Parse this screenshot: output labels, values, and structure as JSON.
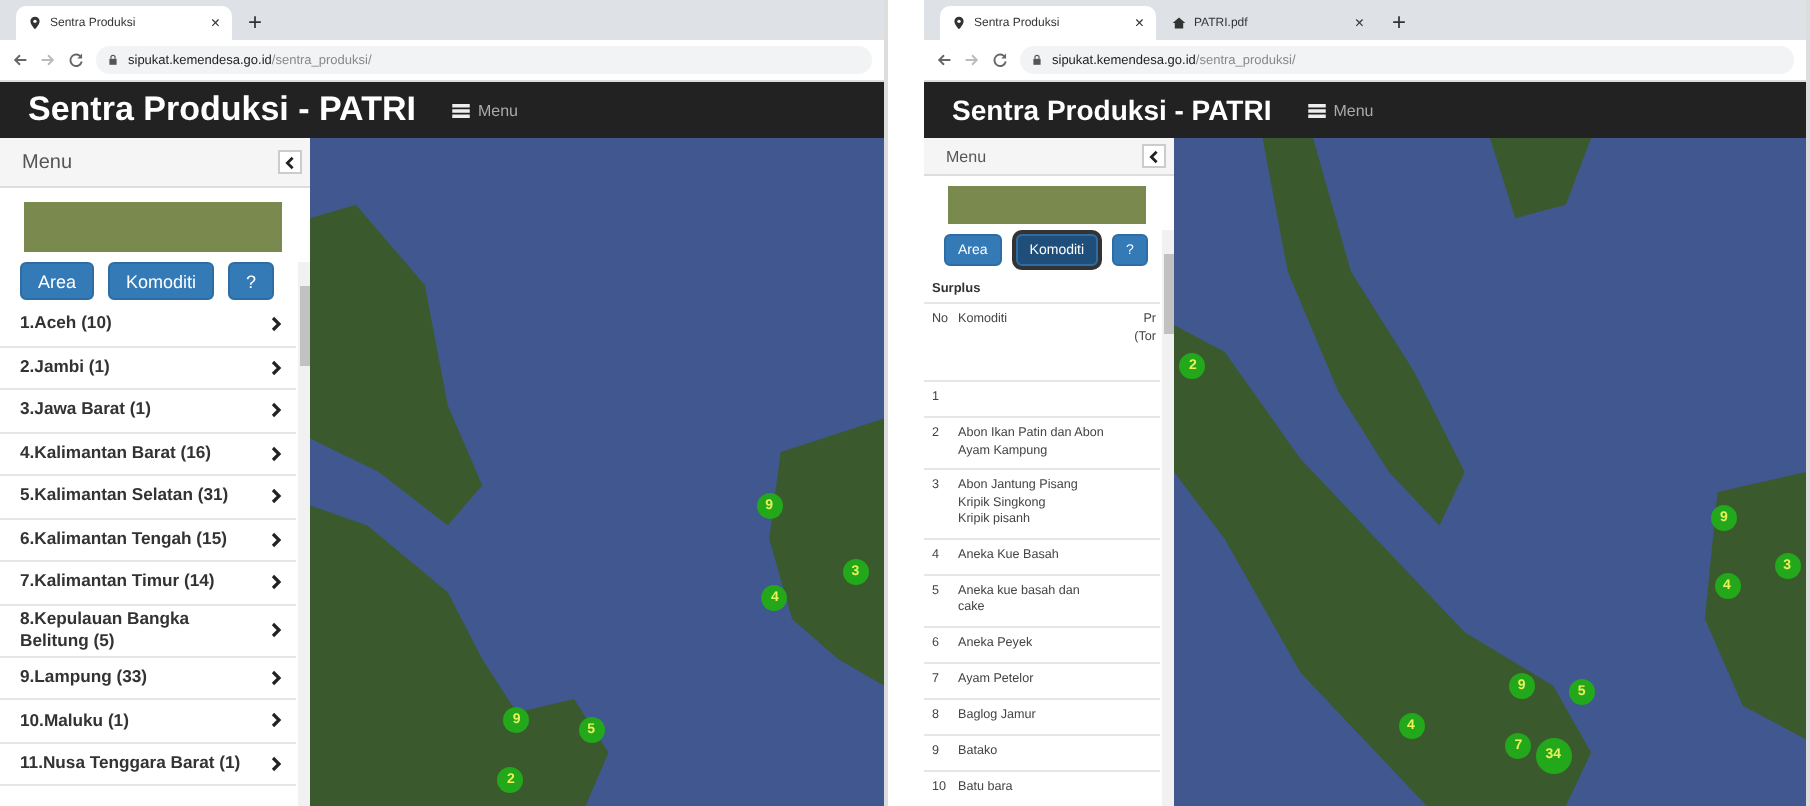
{
  "panels": [
    {
      "browser": {
        "tabs": [
          {
            "title": "Sentra Produksi",
            "close": "×",
            "selected": true
          }
        ],
        "new_tab": "+",
        "url_host": "sipukat.kemendesa.go.id",
        "url_path": "/sentra_produksi/"
      },
      "app": {
        "title": "Sentra Produksi - PATRI",
        "menu_label": "Menu"
      },
      "sidebar": {
        "kind": "list",
        "title": "Menu",
        "buttons": [
          {
            "label": "Area",
            "selected": false
          },
          {
            "label": "Komoditi",
            "selected": false
          },
          {
            "label": "?",
            "selected": false
          }
        ],
        "items": [
          {
            "label": "1.Aceh (10)"
          },
          {
            "label": "2.Jambi (1)"
          },
          {
            "label": "3.Jawa Barat (1)"
          },
          {
            "label": "4.Kalimantan Barat (16)"
          },
          {
            "label": "5.Kalimantan Selatan (31)"
          },
          {
            "label": "6.Kalimantan Tengah (15)"
          },
          {
            "label": "7.Kalimantan Timur (14)"
          },
          {
            "label": "8.Kepulauan Bangka Belitung (5)"
          },
          {
            "label": "9.Lampung (33)"
          },
          {
            "label": "10.Maluku (1)"
          },
          {
            "label": "11.Nusa Tenggara Barat (1)"
          }
        ]
      },
      "map": {
        "markers": [
          "9",
          "3",
          "4",
          "9",
          "5",
          "2"
        ]
      }
    },
    {
      "browser": {
        "tabs": [
          {
            "title": "Sentra Produksi",
            "close": "×",
            "selected": true
          },
          {
            "title": "PATRI.pdf",
            "close": "×",
            "selected": false
          }
        ],
        "new_tab": "+",
        "url_host": "sipukat.kemendesa.go.id",
        "url_path": "/sentra_produksi/"
      },
      "app": {
        "title": "Sentra Produksi - PATRI",
        "menu_label": "Menu"
      },
      "sidebar": {
        "kind": "table",
        "title": "Menu",
        "buttons": [
          {
            "label": "Area",
            "selected": false
          },
          {
            "label": "Komoditi",
            "selected": true
          },
          {
            "label": "?",
            "selected": false
          }
        ],
        "section": "Surplus",
        "columns": [
          "No",
          "Komoditi",
          "Pr\n(Tor"
        ],
        "rows": [
          [
            "1",
            ""
          ],
          [
            "2",
            "Abon Ikan Patin dan Abon Ayam Kampung"
          ],
          [
            "3",
            "Abon Jantung Pisang\nKripik Singkong\nKripik pisanh"
          ],
          [
            "4",
            "Aneka Kue Basah"
          ],
          [
            "5",
            "Aneka kue basah dan cake"
          ],
          [
            "6",
            "Aneka Peyek"
          ],
          [
            "7",
            "Ayam Petelor"
          ],
          [
            "8",
            "Baglog Jamur"
          ],
          [
            "9",
            "Batako"
          ],
          [
            "10",
            "Batu bara"
          ]
        ]
      },
      "map": {
        "markers": [
          "2",
          "9",
          "3",
          "4",
          "9",
          "5",
          "4",
          "7",
          "34"
        ]
      }
    }
  ]
}
